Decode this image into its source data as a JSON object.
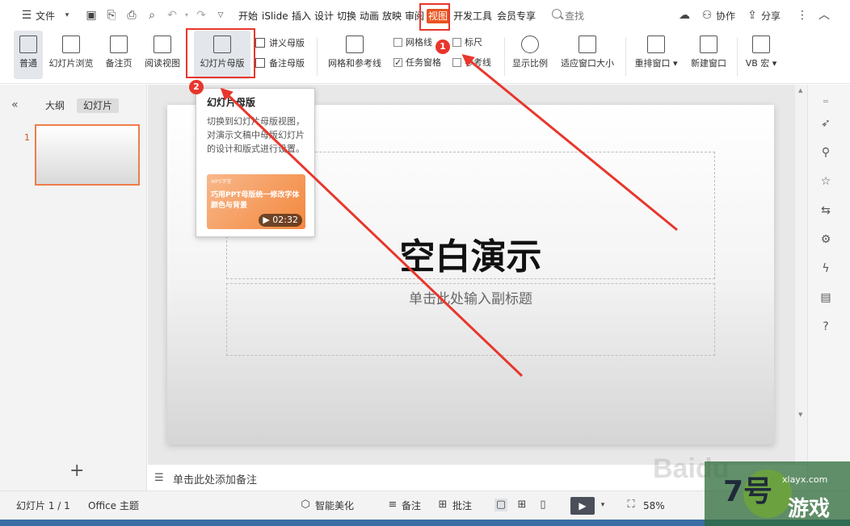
{
  "menubar": {
    "file_label": "文件",
    "tabs": [
      "开始",
      "iSlide",
      "插入",
      "设计",
      "切换",
      "动画",
      "放映",
      "审阅",
      "视图",
      "开发工具",
      "会员专享"
    ],
    "active_tab": "视图",
    "search_label": "查找",
    "collab_label": "协作",
    "share_label": "分享"
  },
  "ribbon": {
    "normal_label": "普通",
    "slide_sorter_label": "幻灯片浏览",
    "notes_page_label": "备注页",
    "reading_view_label": "阅读视图",
    "slide_master_label": "幻灯片母版",
    "handout_master_label": "讲义母版",
    "notes_master_label": "备注母版",
    "grid_guides_label": "网格和参考线",
    "gridlines_label": "网格线",
    "ruler_label": "标尺",
    "task_pane_label": "任务窗格",
    "guides_label": "参考线",
    "zoom_label": "显示比例",
    "fit_window_label": "适应窗口大小",
    "arrange_label": "重排窗口",
    "new_window_label": "新建窗口",
    "vb_label": "VB 宏"
  },
  "left_pane": {
    "outline_tab": "大纲",
    "slides_tab": "幻灯片",
    "slide_number": "1"
  },
  "slide": {
    "title": "空白演示",
    "subtitle": "单击此处输入副标题"
  },
  "notes": {
    "placeholder": "单击此处添加备注"
  },
  "statusbar": {
    "slide_info": "幻灯片 1 / 1",
    "theme": "Office 主题",
    "beautify": "智能美化",
    "notes": "备注",
    "comments": "批注",
    "zoom": "58%"
  },
  "tooltip": {
    "title": "幻灯片母版",
    "body": "切换到幻灯片母版视图，对演示文稿中母版幻灯片的设计和版式进行设置。",
    "card_tag": "WPS学堂",
    "card_text": "巧用PPT母版统一修改字体颜色与背景",
    "duration": "02:32"
  },
  "annotations": {
    "badge1": "1",
    "badge2": "2",
    "color": "#e8362c"
  },
  "watermarks": {
    "baidu": "Baidu",
    "site_num": "7号",
    "site_url": "xlayx.com",
    "site_cn": "游戏"
  },
  "colors": {
    "accent": "#e9541f",
    "thumb_border": "#f07c4a"
  }
}
